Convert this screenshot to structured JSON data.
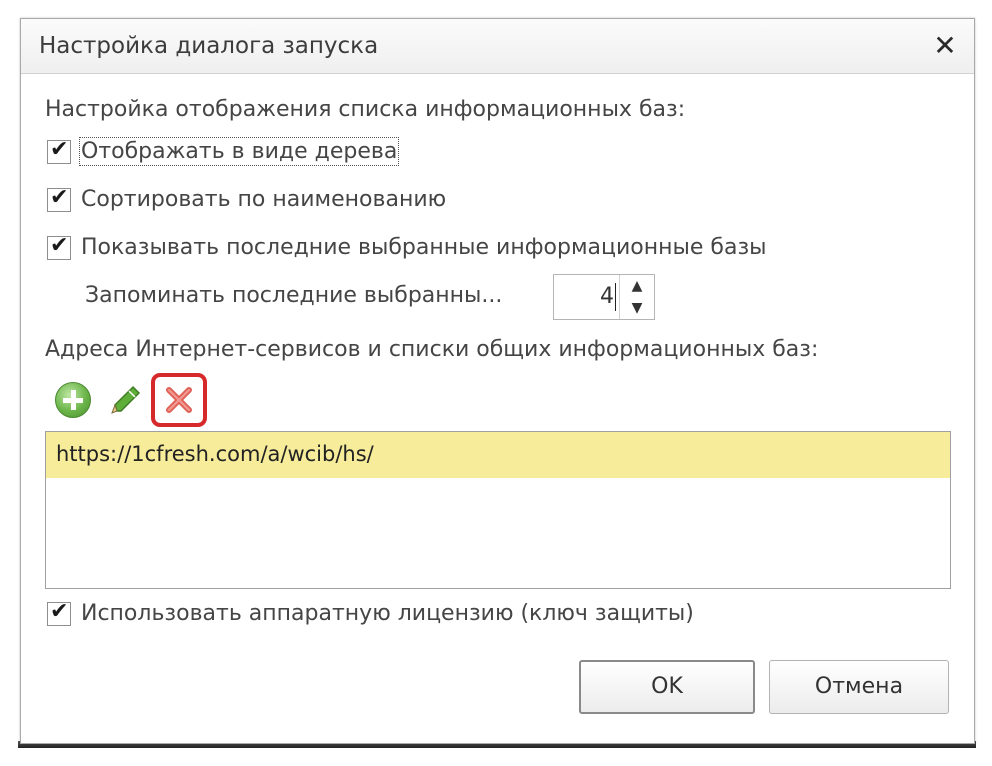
{
  "dialog": {
    "title": "Настройка диалога запуска",
    "close_label": "✕"
  },
  "display_settings": {
    "heading": "Настройка отображения списка информационных баз:",
    "show_as_tree": {
      "label": "Отображать в виде дерева",
      "checked": true
    },
    "sort_by_name": {
      "label": "Сортировать по наименованию",
      "checked": true
    },
    "show_recent": {
      "label": "Показывать последние выбранные информационные базы",
      "checked": true
    },
    "remember_recent": {
      "label": "Запоминать последние выбранны...",
      "value": "4"
    }
  },
  "services": {
    "heading": "Адреса Интернет-сервисов и списки общих информационных баз:",
    "toolbar": {
      "add_icon": "add-circle-icon",
      "edit_icon": "pencil-icon",
      "delete_icon": "delete-x-icon"
    },
    "items": [
      "https://1cfresh.com/a/wcib/hs/"
    ]
  },
  "hardware_license": {
    "label": "Использовать аппаратную лицензию (ключ защиты)",
    "checked": true
  },
  "buttons": {
    "ok": "OK",
    "cancel": "Отмена"
  },
  "colors": {
    "selected_row": "#f6ec9a",
    "highlight_border": "#d62a2a"
  }
}
